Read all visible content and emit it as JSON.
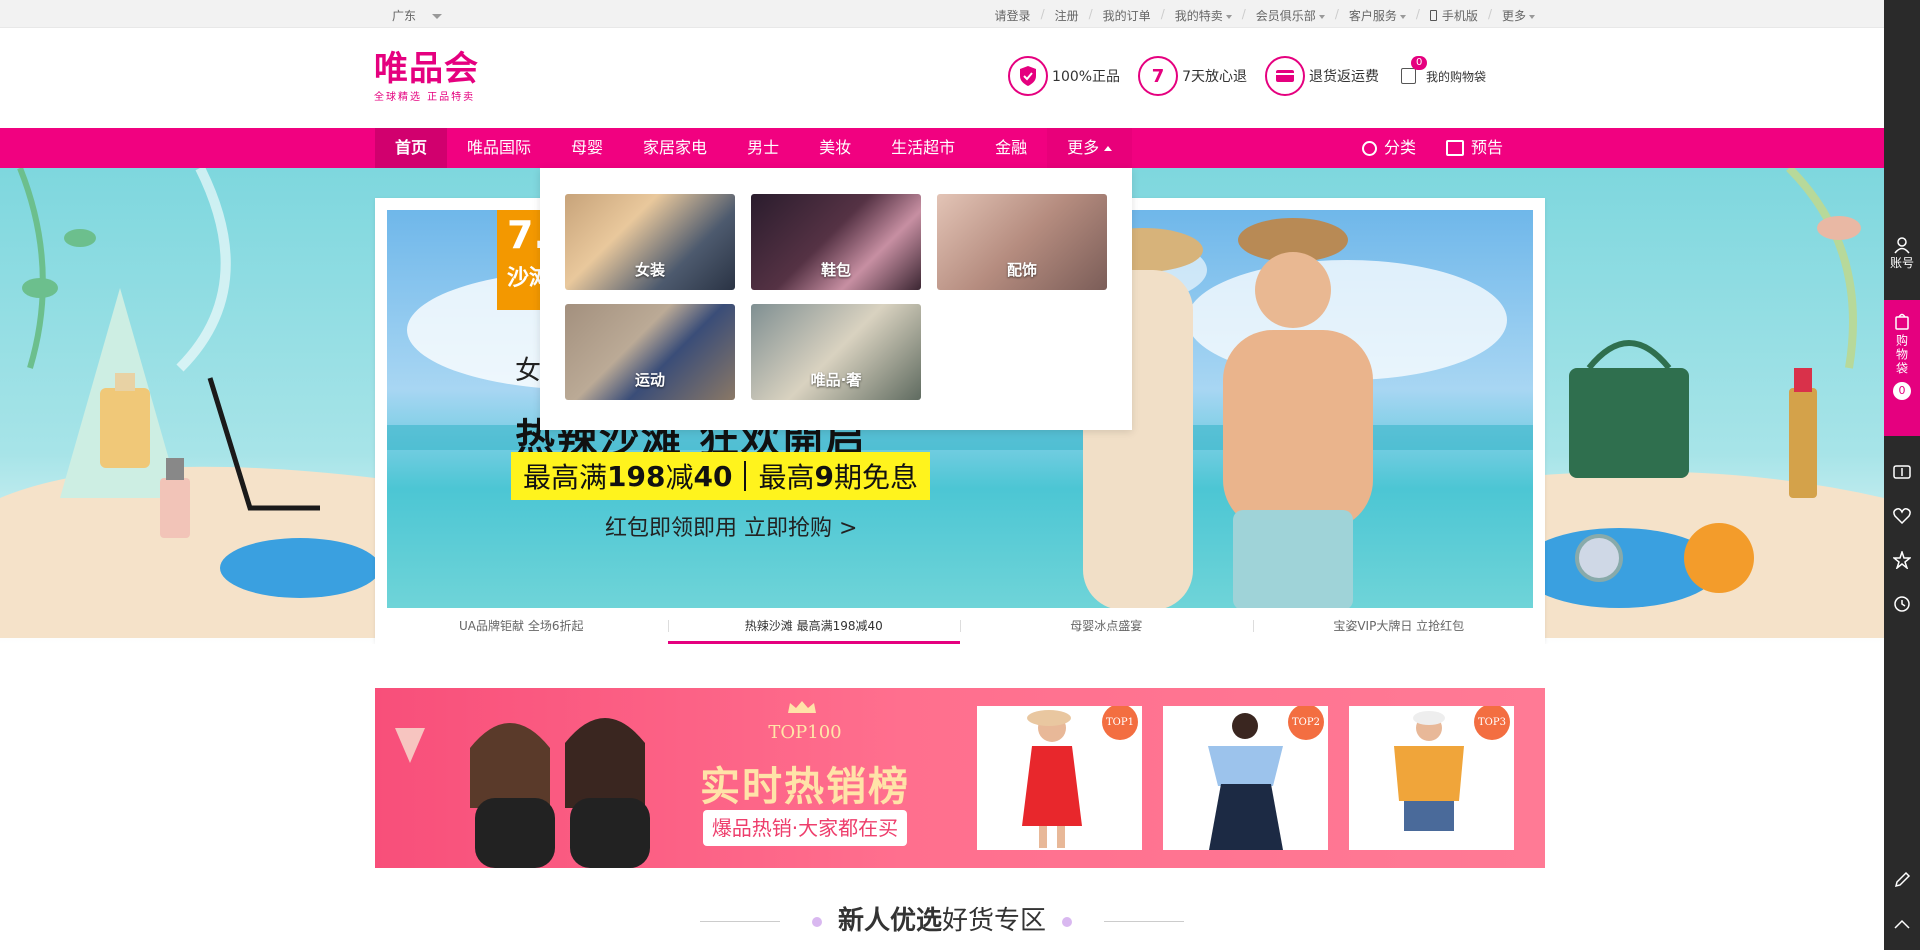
{
  "topbar": {
    "region": "广东",
    "links": [
      "请登录",
      "注册",
      "我的订单",
      "我的特卖",
      "会员俱乐部",
      "客户服务",
      "手机版",
      "更多"
    ]
  },
  "header": {
    "logo_main": "唯品会",
    "logo_sub": "全球精选 正品特卖",
    "promises": [
      {
        "badge": "✓",
        "label": "100%正品"
      },
      {
        "badge": "7",
        "label": "7天放心退"
      },
      {
        "badge": "▭",
        "label": "退货返运费"
      }
    ],
    "cart_label": "我的购物袋",
    "cart_count": "0"
  },
  "nav": {
    "items": [
      "首页",
      "唯品国际",
      "母婴",
      "家居家电",
      "男士",
      "美妆",
      "生活超市",
      "金融",
      "更多"
    ],
    "right": [
      "分类",
      "预告"
    ]
  },
  "dropdown": {
    "cards": [
      "女装",
      "鞋包",
      "配饰",
      "运动",
      "唯品·奢"
    ]
  },
  "hero": {
    "date_tag_1": "7.",
    "date_tag_2": "沙滩",
    "pre_text": "女",
    "headline": "热辣沙滩 狂欢開启",
    "offer_1_a": "最高满",
    "offer_1_b": "198",
    "offer_1_c": "减",
    "offer_1_d": "40",
    "offer_2_a": "最高",
    "offer_2_b": "9",
    "offer_2_c": "期免息",
    "cta": "红包即领即用  立即抢购 >",
    "tabs": [
      "UA品牌钜献 全场6折起",
      "热辣沙滩 最高满198减40",
      "母婴冰点盛宴",
      "宝姿VIP大牌日 立抢红包"
    ],
    "active_tab": 1
  },
  "hot": {
    "top100": "TOP100",
    "title": "实时热销榜",
    "sub": "爆品热销·大家都在买",
    "ranks": [
      "TOP1",
      "TOP2",
      "TOP3"
    ]
  },
  "section": {
    "title_bold": "新人优选",
    "title_rest": "好货专区"
  },
  "rail": {
    "account": "账号",
    "cart": "购物袋",
    "cart_count": "0"
  },
  "colors": {
    "brand": "#e5007f",
    "nav_bg": "#f10180"
  }
}
